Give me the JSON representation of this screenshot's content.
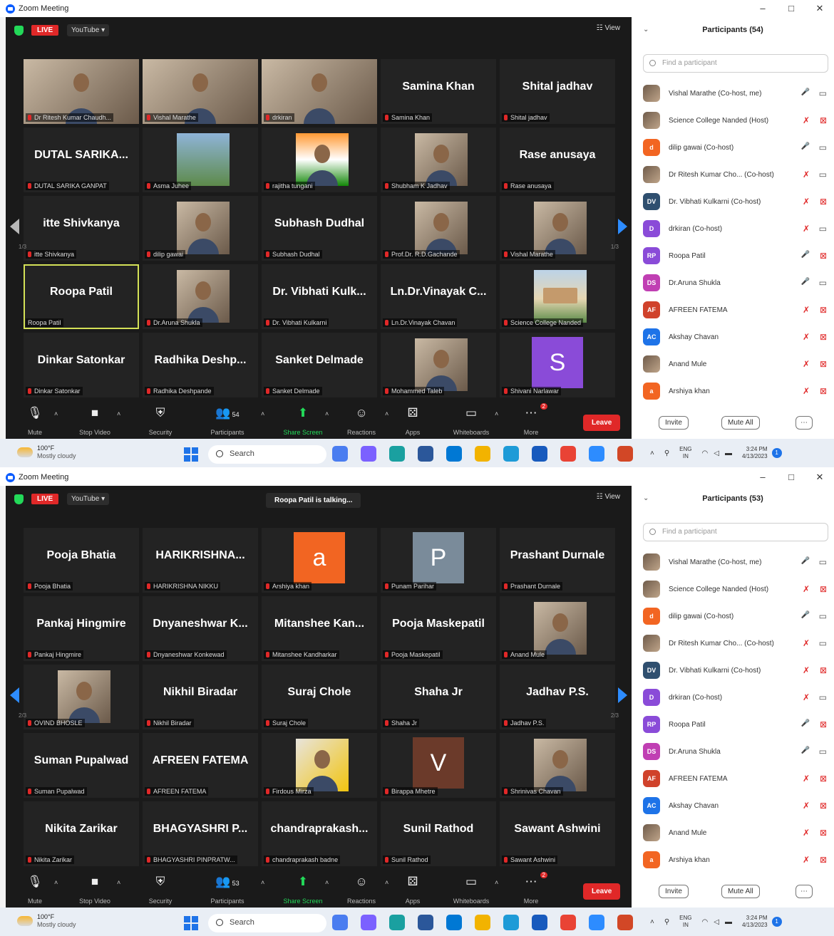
{
  "window_controls": [
    "–",
    "□",
    "✕"
  ],
  "taskbar": {
    "temp": "100°F",
    "weather": "Mostly cloudy",
    "search": "Search",
    "lang_line1": "ENG",
    "lang_line2": "IN",
    "time": "3:24 PM",
    "date": "4/13/2023",
    "notif": "1",
    "app_colors": [
      "#4a7df0",
      "#7b61ff",
      "#1aa0a0",
      "#2b579a",
      "#0078d4",
      "#f2b300",
      "#1e9bd7",
      "#185abd",
      "#e94335",
      "#2d8cff",
      "#d24726"
    ]
  },
  "toolbar": {
    "mute": "Mute",
    "stop_video": "Stop Video",
    "security": "Security",
    "participants": "Participants",
    "share_screen": "Share Screen",
    "reactions": "Reactions",
    "apps": "Apps",
    "whiteboards": "Whiteboards",
    "more": "More",
    "more_badge": "2",
    "leave": "Leave"
  },
  "panel_common": {
    "search_placeholder": "Find a participant",
    "invite": "Invite",
    "mute_all": "Mute All"
  },
  "top": {
    "app_title": "Zoom Meeting",
    "live": "LIVE",
    "stream": "YouTube ▾",
    "view": "View",
    "page_left": "1/3",
    "page_right": "1/3",
    "participant_count_label": "54",
    "panel_title": "Participants (54)",
    "tiles": [
      {
        "label": "Dr Ritesh Kumar Chaudh...",
        "photo": "full"
      },
      {
        "label": "Vishal Marathe",
        "photo": "full"
      },
      {
        "label": "drkiran",
        "photo": "full"
      },
      {
        "name": "Samina Khan",
        "label": "Samina Khan"
      },
      {
        "name": "Shital jadhav",
        "label": "Shital jadhav"
      },
      {
        "name": "DUTAL SARIKA...",
        "label": "DUTAL SARIKA GANPAT"
      },
      {
        "label": "Asma Juhee",
        "photo": "landscape"
      },
      {
        "label": "rajitha tungani",
        "photo": "flag"
      },
      {
        "label": "Shubham K Jadhav",
        "photo": "small"
      },
      {
        "name": "Rase anusaya",
        "label": "Rase anusaya"
      },
      {
        "name": "itte Shivkanya",
        "label": "itte Shivkanya"
      },
      {
        "label": "dilip gawai",
        "photo": "small"
      },
      {
        "name": "Subhash Dudhal",
        "label": "Subhash Dudhal"
      },
      {
        "label": "Prof.Dr. R.D.Gachande",
        "photo": "small"
      },
      {
        "label": "Vishal Marathe",
        "photo": "small"
      },
      {
        "name": "Roopa Patil",
        "label": "Roopa Patil",
        "highlight": true
      },
      {
        "label": "Dr.Aruna Shukla",
        "photo": "small"
      },
      {
        "name": "Dr. Vibhati Kulk...",
        "label": "Dr. Vibhati Kulkarni"
      },
      {
        "name": "Ln.Dr.Vinayak C...",
        "label": "Ln.Dr.Vinayak Chavan"
      },
      {
        "label": "Science College Nanded",
        "photo": "building"
      },
      {
        "name": "Dinkar Satonkar",
        "label": "Dinkar Satonkar"
      },
      {
        "name": "Radhika Deshp...",
        "label": "Radhika Deshpande"
      },
      {
        "name": "Sanket Delmade",
        "label": "Sanket Delmade"
      },
      {
        "label": "Mohammed Taleb",
        "photo": "small"
      },
      {
        "label": "Shivani Narlawar",
        "avatar": "S",
        "avatar_color": "#8a4bd8"
      }
    ]
  },
  "bottom": {
    "app_title": "Zoom Meeting",
    "live": "LIVE",
    "stream": "YouTube ▾",
    "talking": "Roopa Patil is talking...",
    "view": "View",
    "page_left": "2/3",
    "page_right": "2/3",
    "participant_count_label": "53",
    "panel_title": "Participants (53)",
    "tiles": [
      {
        "name": "Pooja Bhatia",
        "label": "Pooja Bhatia"
      },
      {
        "name": "HARIKRISHNA...",
        "label": "HARIKRISHNA NIKKU"
      },
      {
        "label": "Arshiya khan",
        "avatar": "a",
        "avatar_color": "#f26522"
      },
      {
        "label": "Punam Parihar",
        "avatar": "P",
        "avatar_color": "#7a8b9a"
      },
      {
        "name": "Prashant Durnale",
        "label": "Prashant Durnale"
      },
      {
        "name": "Pankaj Hingmire",
        "label": "Pankaj Hingmire"
      },
      {
        "name": "Dnyaneshwar K...",
        "label": "Dnyaneshwar Konkewad"
      },
      {
        "name": "Mitanshee Kan...",
        "label": "Mitanshee Kandharkar"
      },
      {
        "name": "Pooja Maskepatil",
        "label": "Pooja Maskepatil"
      },
      {
        "label": "Anand Mule",
        "photo": "small"
      },
      {
        "label": "OVIND BHOSLE",
        "photo": "small"
      },
      {
        "name": "Nikhil Biradar",
        "label": "Nikhil Biradar"
      },
      {
        "name": "Suraj Chole",
        "label": "Suraj Chole"
      },
      {
        "name": "Shaha Jr",
        "label": "Shaha Jr"
      },
      {
        "name": "Jadhav P.S.",
        "label": "Jadhav P.S."
      },
      {
        "name": "Suman Pupalwad",
        "label": "Suman Pupalwad"
      },
      {
        "name": "AFREEN FATEMA",
        "label": "AFREEN FATEMA"
      },
      {
        "label": "Firdous Mirza",
        "photo": "yellow"
      },
      {
        "label": "Birappa Mhetre",
        "avatar": "V",
        "avatar_color": "#6b3a2a"
      },
      {
        "label": "Shrinivas Chavan",
        "photo": "small"
      },
      {
        "name": "Nikita Zarikar",
        "label": "Nikita Zarikar"
      },
      {
        "name": "BHAGYASHRI P...",
        "label": "BHAGYASHRI PINPRATW..."
      },
      {
        "name": "chandraprakash...",
        "label": "chandraprakash badne"
      },
      {
        "name": "Sunil Rathod",
        "label": "Sunil Rathod"
      },
      {
        "name": "Sawant Ashwini",
        "label": "Sawant Ashwini"
      }
    ]
  },
  "participants_top": [
    {
      "name": "Vishal Marathe (Co-host, me)",
      "initials": "",
      "color": "",
      "mic": "on",
      "cam": "on"
    },
    {
      "name": "Science College Nanded (Host)",
      "initials": "",
      "color": "",
      "mic": "off",
      "cam": "off"
    },
    {
      "name": "dilip gawai (Co-host)",
      "initials": "d",
      "color": "#f26522",
      "mic": "on",
      "cam": "on"
    },
    {
      "name": "Dr Ritesh Kumar Cho... (Co-host)",
      "initials": "",
      "color": "",
      "mic": "off",
      "cam": "on"
    },
    {
      "name": "Dr. Vibhati Kulkarni (Co-host)",
      "initials": "DV",
      "color": "#2f4f6f",
      "mic": "off",
      "cam": "off"
    },
    {
      "name": "drkiran (Co-host)",
      "initials": "D",
      "color": "#8a4bd8",
      "mic": "off",
      "cam": "on"
    },
    {
      "name": "Roopa Patil",
      "initials": "RP",
      "color": "#8a4bd8",
      "mic": "on",
      "cam": "off"
    },
    {
      "name": "Dr.Aruna Shukla",
      "initials": "DS",
      "color": "#c03fb3",
      "mic": "on",
      "cam": "on"
    },
    {
      "name": "AFREEN FATEMA",
      "initials": "AF",
      "color": "#d0422b",
      "mic": "off",
      "cam": "off"
    },
    {
      "name": "Akshay Chavan",
      "initials": "AC",
      "color": "#1e73e8",
      "mic": "off",
      "cam": "off"
    },
    {
      "name": "Anand Mule",
      "initials": "",
      "color": "",
      "mic": "off",
      "cam": "off"
    },
    {
      "name": "Arshiya khan",
      "initials": "a",
      "color": "#f26522",
      "mic": "off",
      "cam": "off"
    }
  ],
  "participants_bottom": [
    {
      "name": "Vishal Marathe (Co-host, me)",
      "initials": "",
      "color": "",
      "mic": "on",
      "cam": "on"
    },
    {
      "name": "Science College Nanded (Host)",
      "initials": "",
      "color": "",
      "mic": "off",
      "cam": "off"
    },
    {
      "name": "dilip gawai (Co-host)",
      "initials": "d",
      "color": "#f26522",
      "mic": "on",
      "cam": "on"
    },
    {
      "name": "Dr Ritesh Kumar Cho... (Co-host)",
      "initials": "",
      "color": "",
      "mic": "off",
      "cam": "on"
    },
    {
      "name": "Dr. Vibhati Kulkarni (Co-host)",
      "initials": "DV",
      "color": "#2f4f6f",
      "mic": "off",
      "cam": "off"
    },
    {
      "name": "drkiran (Co-host)",
      "initials": "D",
      "color": "#8a4bd8",
      "mic": "off",
      "cam": "on"
    },
    {
      "name": "Roopa Patil",
      "initials": "RP",
      "color": "#8a4bd8",
      "mic": "on",
      "cam": "off"
    },
    {
      "name": "Dr.Aruna Shukla",
      "initials": "DS",
      "color": "#c03fb3",
      "mic": "on",
      "cam": "on"
    },
    {
      "name": "AFREEN FATEMA",
      "initials": "AF",
      "color": "#d0422b",
      "mic": "off",
      "cam": "off"
    },
    {
      "name": "Akshay Chavan",
      "initials": "AC",
      "color": "#1e73e8",
      "mic": "off",
      "cam": "off"
    },
    {
      "name": "Anand Mule",
      "initials": "",
      "color": "",
      "mic": "off",
      "cam": "off"
    },
    {
      "name": "Arshiya khan",
      "initials": "a",
      "color": "#f26522",
      "mic": "off",
      "cam": "off"
    }
  ]
}
